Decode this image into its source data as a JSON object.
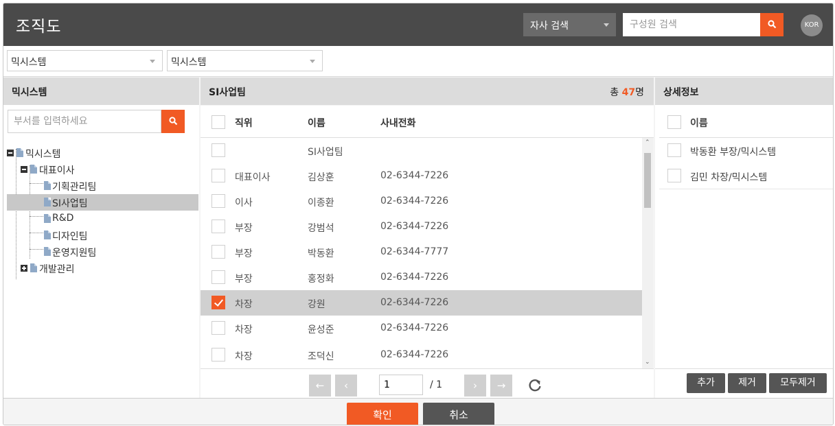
{
  "header": {
    "title": "조직도",
    "company_search_label": "자사 검색",
    "member_search_placeholder": "구성원 검색",
    "lang": "KOR"
  },
  "filters": {
    "select1": "믹시스템",
    "select2": "믹시스템"
  },
  "left": {
    "header": "믹시스템",
    "dept_placeholder": "부서를 입력하세요",
    "tree": [
      "믹시스템",
      "대표이사",
      "기획관리팀",
      "SI사업팀",
      "R&D",
      "디자인팀",
      "운영지원팀",
      "개발관리"
    ]
  },
  "center": {
    "header": "SI사업팀",
    "total_prefix": "총",
    "total_count": "47",
    "total_suffix": "명",
    "columns": [
      "직위",
      "이름",
      "사내전화"
    ],
    "rows": [
      {
        "pos": "",
        "name": "SI사업팀",
        "tel": ""
      },
      {
        "pos": "대표이사",
        "name": "김상훈",
        "tel": "02-6344-7226"
      },
      {
        "pos": "이사",
        "name": "이종환",
        "tel": "02-6344-7226"
      },
      {
        "pos": "부장",
        "name": "강범석",
        "tel": "02-6344-7226"
      },
      {
        "pos": "부장",
        "name": "박동환",
        "tel": "02-6344-7777"
      },
      {
        "pos": "부장",
        "name": "홍정화",
        "tel": "02-6344-7226"
      },
      {
        "pos": "차장",
        "name": "강원",
        "tel": "02-6344-7226"
      },
      {
        "pos": "차장",
        "name": "윤성준",
        "tel": "02-6344-7226"
      },
      {
        "pos": "차장",
        "name": "조덕신",
        "tel": "02-6344-7226"
      }
    ],
    "page_value": "1",
    "page_total": "/ 1"
  },
  "right": {
    "header": "상세정보",
    "column": "이름",
    "items": [
      "박동환 부장/믹시스템",
      "김민 차장/믹시스템"
    ],
    "add": "추가",
    "remove": "제거",
    "remove_all": "모두제거"
  },
  "footer": {
    "confirm": "확인",
    "cancel": "취소"
  },
  "colors": {
    "accent": "#f15a24",
    "header_bg": "#4a4a4a",
    "dark_button": "#555555"
  }
}
